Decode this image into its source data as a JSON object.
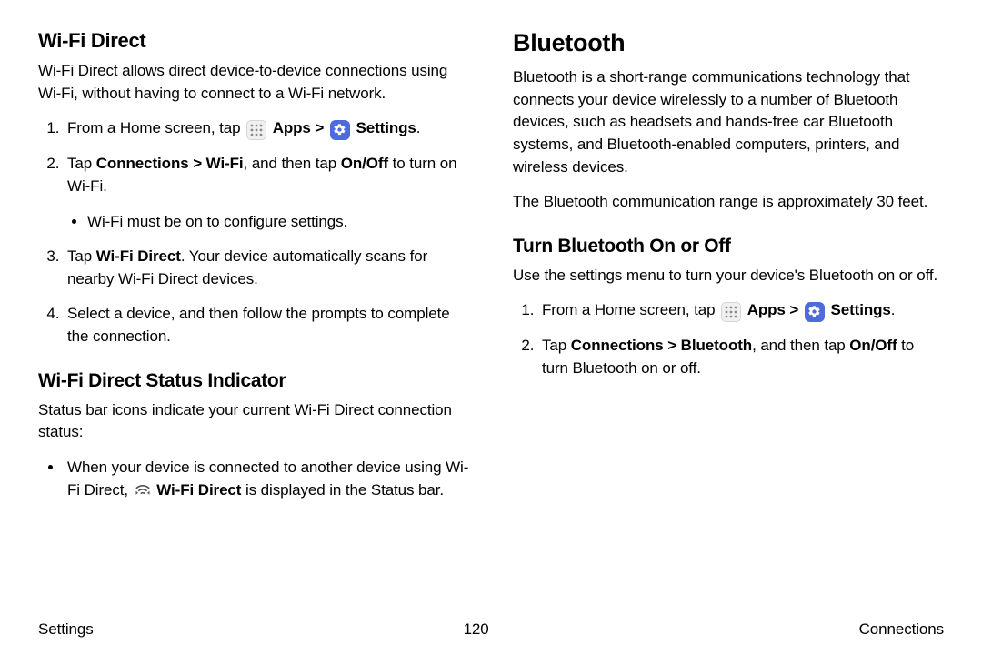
{
  "left": {
    "h_wifidirect": "Wi-Fi Direct",
    "p_wifidirect_intro": "Wi-Fi Direct allows direct device-to-device connections using Wi-Fi, without having to connect to a Wi-Fi network.",
    "step1_pre": "From a Home screen, tap ",
    "apps_label": "Apps",
    "chevron": " > ",
    "settings_label": "Settings",
    "period": ".",
    "step2_pre": "Tap ",
    "step2_b1": "Connections > Wi-Fi",
    "step2_mid": ", and then tap ",
    "step2_b2": "On/Off",
    "step2_post": " to turn on Wi-Fi.",
    "step2_bullet": "Wi-Fi must be on to configure settings.",
    "step3_pre": "Tap ",
    "step3_b": "Wi-Fi Direct",
    "step3_post": ". Your device automatically scans for nearby Wi-Fi Direct devices.",
    "step4": "Select a device, and then follow the prompts to complete the connection.",
    "h_status": "Wi-Fi Direct Status Indicator",
    "p_status_intro": "Status bar icons indicate your current Wi-Fi Direct connection status:",
    "status_bullet_pre": "When your device is connected to another device using Wi-Fi Direct, ",
    "status_bullet_b": "Wi-Fi Direct",
    "status_bullet_post": " is displayed in the Status bar."
  },
  "right": {
    "h_bluetooth": "Bluetooth",
    "p_bt_intro": "Bluetooth is a short-range communications technology that connects your device wirelessly to a number of Bluetooth devices, such as headsets and hands-free car Bluetooth systems, and Bluetooth-enabled computers, printers, and wireless devices.",
    "p_bt_range": "The Bluetooth communication range is approximately 30 feet.",
    "h_turn": "Turn Bluetooth On or Off",
    "p_turn_intro": "Use the settings menu to turn your device's Bluetooth on or off.",
    "bt_step2_pre": "Tap ",
    "bt_step2_b1": "Connections > Bluetooth",
    "bt_step2_mid": ", and then tap ",
    "bt_step2_b2": "On/Off",
    "bt_step2_post": " to turn Bluetooth on or off."
  },
  "footer": {
    "left": "Settings",
    "center": "120",
    "right": "Connections"
  }
}
